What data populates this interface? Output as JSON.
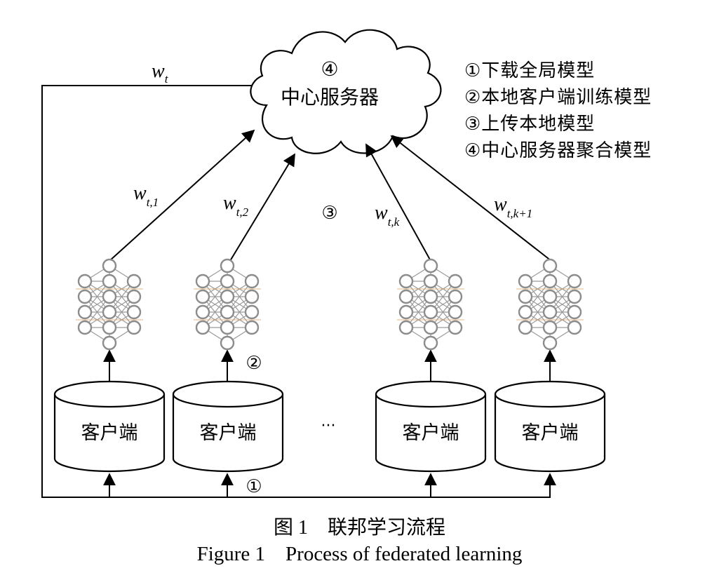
{
  "server": {
    "step": "④",
    "label": "中心服务器"
  },
  "weights": {
    "global": {
      "base": "w",
      "sub": "t"
    },
    "client1": {
      "base": "w",
      "sub": "t,1"
    },
    "client2": {
      "base": "w",
      "sub": "t,2"
    },
    "clientk": {
      "base": "w",
      "sub": "t,k"
    },
    "clientk1": {
      "base": "w",
      "sub": "t,k+1"
    }
  },
  "steps": {
    "download": "①",
    "train": "②",
    "upload": "③"
  },
  "clients": [
    {
      "label": "客户端"
    },
    {
      "label": "客户端"
    },
    {
      "label": "客户端"
    },
    {
      "label": "客户端"
    }
  ],
  "ellipsis": "···",
  "legend": [
    "①下载全局模型",
    "②本地客户端训练模型",
    "③上传本地模型",
    "④中心服务器聚合模型"
  ],
  "caption": {
    "cn": "图 1　联邦学习流程",
    "en": "Figure 1　Process of federated learning"
  }
}
